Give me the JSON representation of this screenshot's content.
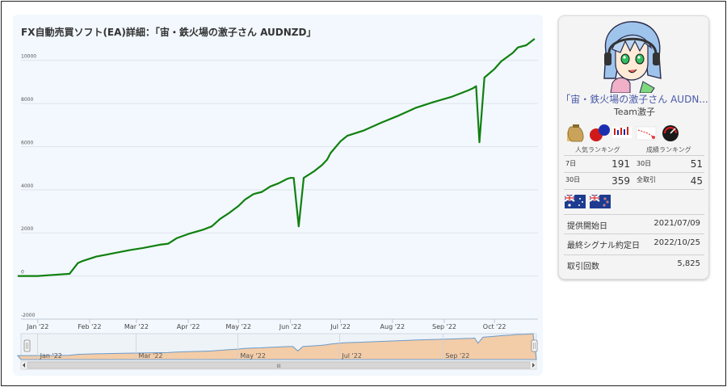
{
  "page": {
    "title": "FX自動売買ソフト(EA)詳細：「宙・鉄火場の激子さん AUDNZD」"
  },
  "chart_data": {
    "type": "line",
    "y_ticks": [
      "10000",
      "8000",
      "6000",
      "4000",
      "2000",
      "0",
      "-2000"
    ],
    "ylim": [
      -2000,
      11000
    ],
    "x_ticks": [
      "Jan '22",
      "Feb '22",
      "Mar '22",
      "Apr '22",
      "May '22",
      "Jun '22",
      "Jul '22",
      "Aug '22",
      "Sep '22",
      "Oct '22"
    ],
    "navigator_ticks": [
      "Jan '22",
      "Mar '22",
      "May '22",
      "Jul '22",
      "Sep '22"
    ],
    "scroll_label": "III",
    "grid": true,
    "series": [
      {
        "color": "#108010",
        "x": [
          "2021-12-20",
          "2022-01-01",
          "2022-01-10",
          "2022-01-20",
          "2022-01-25",
          "2022-01-28",
          "2022-02-05",
          "2022-02-15",
          "2022-02-25",
          "2022-03-05",
          "2022-03-15",
          "2022-03-20",
          "2022-03-25",
          "2022-04-01",
          "2022-04-10",
          "2022-04-15",
          "2022-04-20",
          "2022-04-25",
          "2022-05-01",
          "2022-05-05",
          "2022-05-10",
          "2022-05-15",
          "2022-05-20",
          "2022-05-25",
          "2022-05-30",
          "2022-06-01",
          "2022-06-03",
          "2022-06-06",
          "2022-06-09",
          "2022-06-15",
          "2022-06-20",
          "2022-06-23",
          "2022-06-25",
          "2022-07-01",
          "2022-07-05",
          "2022-07-15",
          "2022-07-25",
          "2022-08-05",
          "2022-08-15",
          "2022-08-25",
          "2022-09-05",
          "2022-09-10",
          "2022-09-15",
          "2022-09-18",
          "2022-09-20",
          "2022-09-22",
          "2022-09-25",
          "2022-10-01",
          "2022-10-05",
          "2022-10-12",
          "2022-10-15",
          "2022-10-20",
          "2022-10-25"
        ],
        "y": [
          0,
          0,
          50,
          100,
          600,
          700,
          900,
          1050,
          1200,
          1300,
          1450,
          1500,
          1750,
          1950,
          2150,
          2300,
          2650,
          2900,
          3250,
          3550,
          3800,
          3900,
          4150,
          4300,
          4500,
          4550,
          4550,
          2300,
          4550,
          4850,
          5150,
          5400,
          5700,
          6250,
          6500,
          6750,
          7100,
          7450,
          7800,
          8050,
          8300,
          8450,
          8600,
          8700,
          8800,
          6200,
          9200,
          9600,
          9950,
          10350,
          10600,
          10700,
          11000
        ]
      }
    ],
    "navigator": {
      "type": "area",
      "fill": "#f3cca8",
      "line": "#6c9bc8"
    }
  },
  "card": {
    "ea_name": "「宙・鉄火場の激子さん AUDN...",
    "team": "Team激子",
    "badges": [
      "money-bag-icon",
      "chat-bubbles-icon",
      "candlestick-icon",
      "dotted-chart-icon",
      "speedometer-icon"
    ],
    "ranking": {
      "popular_label": "人気ランキング",
      "results_label": "成績ランキング",
      "rows": [
        {
          "l1": "7日",
          "v1": "191",
          "l2": "30日",
          "v2": "51"
        },
        {
          "l1": "30日",
          "v1": "359",
          "l2": "全取引",
          "v2": "45"
        }
      ]
    },
    "flags": [
      "australia-flag",
      "new-zealand-flag"
    ],
    "info": [
      {
        "label": "提供開始日",
        "value": "2021/07/09"
      },
      {
        "label": "最終シグナル約定日",
        "value": "2022/10/25"
      },
      {
        "label": "取引回数",
        "value": "5,825"
      }
    ]
  }
}
